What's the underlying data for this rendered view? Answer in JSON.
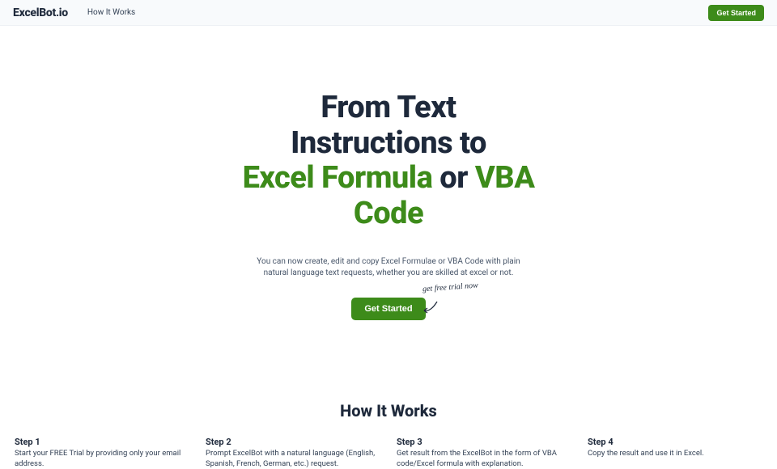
{
  "nav": {
    "logo_pre": "E",
    "logo_x": "x",
    "logo_post": "celBot.io",
    "link1": "How It Works",
    "cta": "Get Started"
  },
  "hero": {
    "line1": "From Text",
    "line2": "Instructions to",
    "green1": "Excel Formula",
    "mid": " or ",
    "green2": "VBA",
    "line4": "Code",
    "subtitle": "You can now create, edit and copy Excel Formulae or VBA Code with plain natural language text requests, whether you are skilled at excel or not.",
    "cta": "Get Started",
    "hint": "get free trial now"
  },
  "how": {
    "title": "How It Works",
    "steps": [
      {
        "title": "Step 1",
        "desc": "Start your FREE Trial by providing only your email address."
      },
      {
        "title": "Step 2",
        "desc": "Prompt ExcelBot with a natural language (English, Spanish, French, German, etc.) request."
      },
      {
        "title": "Step 3",
        "desc": "Get result from the ExcelBot in the form of VBA code/Excel formula with explanation."
      },
      {
        "title": "Step 4",
        "desc": "Copy the result and use it in Excel."
      }
    ]
  }
}
